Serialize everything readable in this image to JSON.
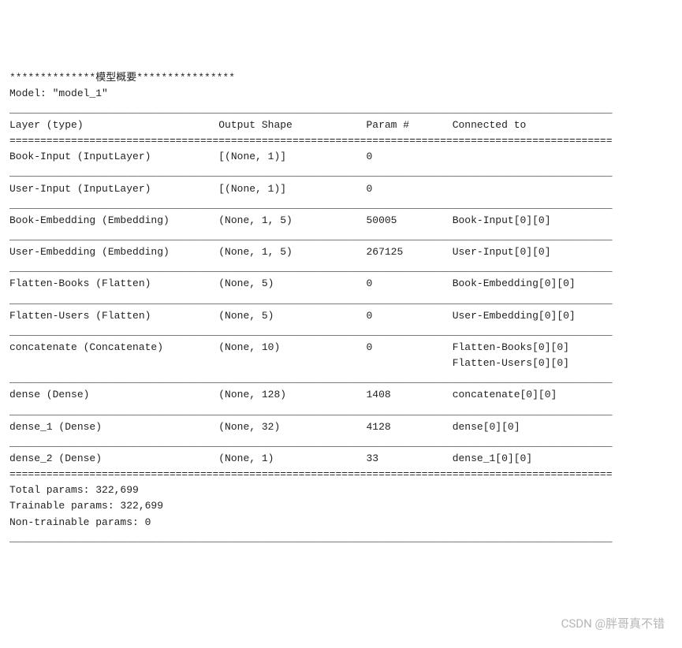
{
  "header_line": "**************模型概要****************",
  "model_line": "Model: \"model_1\"",
  "columns": {
    "layer": "Layer (type)",
    "output": "Output Shape",
    "param": "Param #",
    "connected": "Connected to"
  },
  "rows": [
    {
      "layer": "Book-Input (InputLayer)",
      "output": "[(None, 1)]",
      "param": "0",
      "connected": [
        ""
      ]
    },
    {
      "layer": "User-Input (InputLayer)",
      "output": "[(None, 1)]",
      "param": "0",
      "connected": [
        ""
      ]
    },
    {
      "layer": "Book-Embedding (Embedding)",
      "output": "(None, 1, 5)",
      "param": "50005",
      "connected": [
        "Book-Input[0][0]"
      ]
    },
    {
      "layer": "User-Embedding (Embedding)",
      "output": "(None, 1, 5)",
      "param": "267125",
      "connected": [
        "User-Input[0][0]"
      ]
    },
    {
      "layer": "Flatten-Books (Flatten)",
      "output": "(None, 5)",
      "param": "0",
      "connected": [
        "Book-Embedding[0][0]"
      ]
    },
    {
      "layer": "Flatten-Users (Flatten)",
      "output": "(None, 5)",
      "param": "0",
      "connected": [
        "User-Embedding[0][0]"
      ]
    },
    {
      "layer": "concatenate (Concatenate)",
      "output": "(None, 10)",
      "param": "0",
      "connected": [
        "Flatten-Books[0][0]",
        "Flatten-Users[0][0]"
      ]
    },
    {
      "layer": "dense (Dense)",
      "output": "(None, 128)",
      "param": "1408",
      "connected": [
        "concatenate[0][0]"
      ]
    },
    {
      "layer": "dense_1 (Dense)",
      "output": "(None, 32)",
      "param": "4128",
      "connected": [
        "dense[0][0]"
      ]
    },
    {
      "layer": "dense_2 (Dense)",
      "output": "(None, 1)",
      "param": "33",
      "connected": [
        "dense_1[0][0]"
      ]
    }
  ],
  "footer": {
    "total": "Total params: 322,699",
    "trainable": "Trainable params: 322,699",
    "nontrainable": "Non-trainable params: 0"
  },
  "rule_width": 98,
  "col_widths": {
    "layer": 34,
    "output": 24,
    "param": 14
  },
  "watermark": "CSDN @胖哥真不错"
}
